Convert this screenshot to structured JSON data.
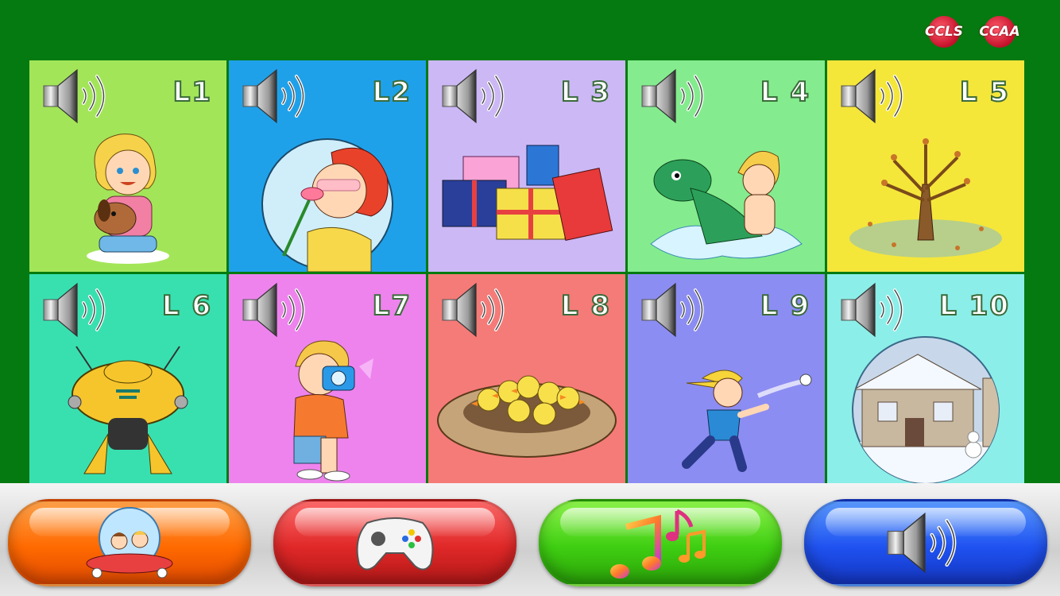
{
  "logos": [
    {
      "text": "CCLS"
    },
    {
      "text": "CCAA"
    }
  ],
  "tiles": [
    {
      "label": "L1",
      "color": "#a3e558",
      "picture": "girl-with-puppy"
    },
    {
      "label": "L2",
      "color": "#1fa1ea",
      "picture": "girl-smelling-flower"
    },
    {
      "label": "L 3",
      "color": "#cbb8f5",
      "picture": "wrapped-gift-boxes"
    },
    {
      "label": "L 4",
      "color": "#84ec8e",
      "picture": "boy-with-dinosaur-splash"
    },
    {
      "label": "L 5",
      "color": "#f5e63a",
      "picture": "autumn-tree"
    },
    {
      "label": "L 6",
      "color": "#38e0b0",
      "picture": "yellow-robot"
    },
    {
      "label": "L7",
      "color": "#ee83ee",
      "picture": "boy-with-camera"
    },
    {
      "label": "L 8",
      "color": "#f57b78",
      "picture": "ducklings-in-nest"
    },
    {
      "label": "L 9",
      "color": "#8c8df2",
      "picture": "boy-throwing-ball"
    },
    {
      "label": "L 10",
      "color": "#8ceee8",
      "picture": "snowy-house"
    }
  ],
  "toolbar": {
    "buttons": [
      {
        "name": "home-button",
        "icon": "kids-bubble-icon",
        "color": "#ff7a10"
      },
      {
        "name": "games-button",
        "icon": "gamepad-icon",
        "color": "#e83030"
      },
      {
        "name": "music-button",
        "icon": "music-notes-icon",
        "color": "#4bd11a"
      },
      {
        "name": "sound-button",
        "icon": "speaker-icon",
        "color": "#2a5df0"
      }
    ]
  }
}
